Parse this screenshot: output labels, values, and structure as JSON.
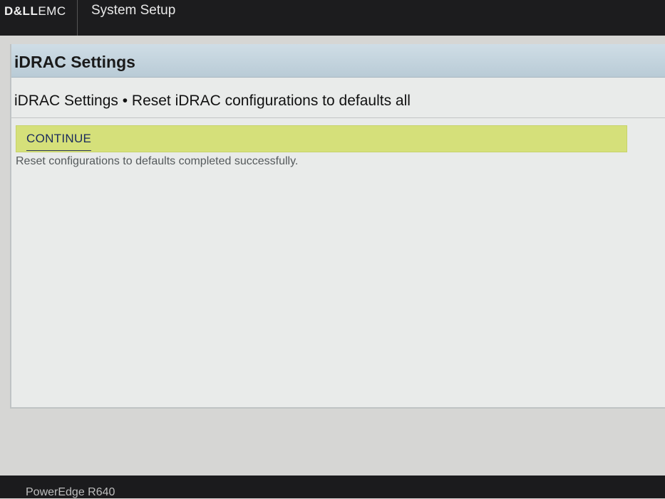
{
  "top_bar": {
    "brand_bold": "D&LL",
    "brand_light": "EMC",
    "app_title": "System Setup"
  },
  "panel": {
    "header_title": "iDRAC Settings",
    "breadcrumb": "iDRAC Settings • Reset iDRAC configurations to defaults all",
    "action_label": "CONTINUE",
    "status_message": "Reset configurations to defaults completed successfully."
  },
  "bottom_bar": {
    "model": "PowerEdge R640"
  },
  "colors": {
    "action_bar": "#d5e07a",
    "header_band": "#c4d4de",
    "chrome": "#1c1c1e"
  }
}
